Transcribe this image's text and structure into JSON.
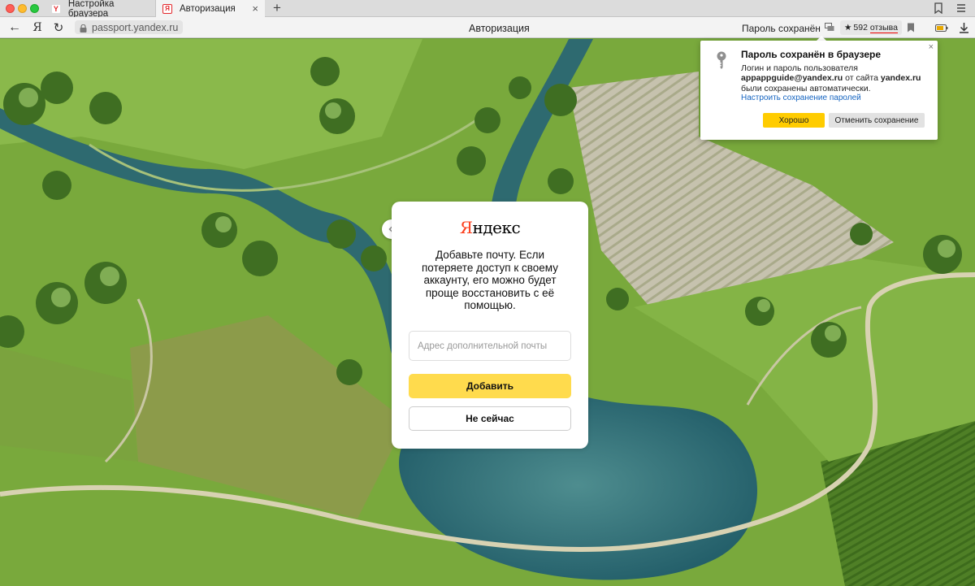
{
  "tabs": [
    {
      "label": "Настройка браузера",
      "favicon": "yandex-browser-icon"
    },
    {
      "label": "Авторизация",
      "favicon": "yandex-ya-icon"
    }
  ],
  "new_tab_label": "+",
  "toolbar": {
    "url": "passport.yandex.ru",
    "page_title": "Авторизация",
    "password_saved": "Пароль сохранён",
    "reviews_count": "592",
    "reviews_label": "отзыва",
    "ya_label": "Я"
  },
  "card": {
    "logo_first": "Я",
    "logo_rest": "ндекс",
    "text": "Добавьте почту. Если потеряете доступ к своему аккаунту, его можно будет проще восстановить с её помощью.",
    "email_placeholder": "Адрес дополнительной почты",
    "add_label": "Добавить",
    "skip_label": "Не сейчас"
  },
  "popup": {
    "title": "Пароль сохранён в браузере",
    "line1": "Логин и пароль пользователя",
    "login": "appappguide@yandex.ru",
    "from_site": "от сайта",
    "site": "yandex.ru",
    "line3": "были сохранены автоматически.",
    "link": "Настроить сохранение паролей",
    "ok_label": "Хорошо",
    "cancel_label": "Отменить сохранение",
    "close": "×"
  },
  "colors": {
    "accent_yellow": "#ffdb4d",
    "popup_yellow": "#ffcc00",
    "brand_red": "#fc3f1d",
    "link_blue": "#1665c1"
  }
}
